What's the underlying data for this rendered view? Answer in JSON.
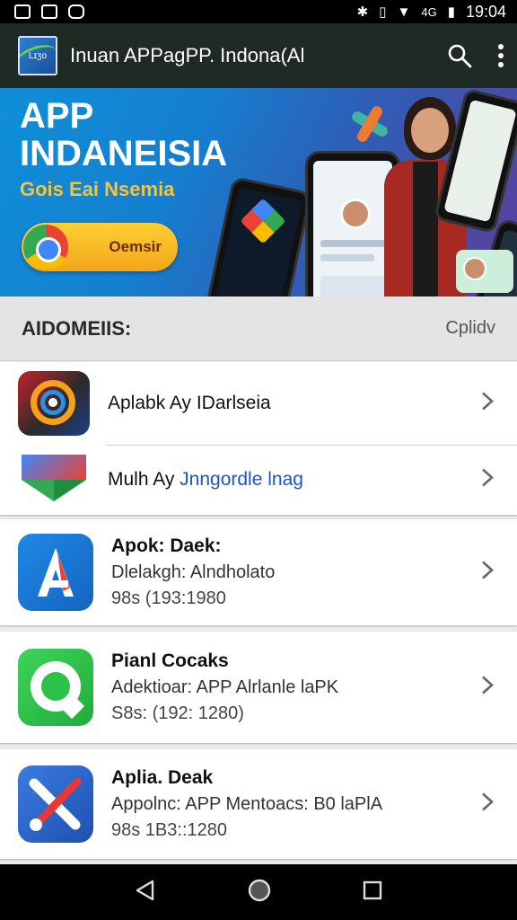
{
  "status_bar": {
    "time": "19:04",
    "network_label": "4G"
  },
  "app_bar": {
    "title": "Inuan APPagPP. Indona(Al",
    "logo_text": "Lɪʒo"
  },
  "banner": {
    "title": "APP\nINDANEISIA",
    "subtitle": "Gois Eai Nsemia",
    "button_label": "Oemsir"
  },
  "section": {
    "title": "AIDOMEIIS:",
    "action": "Cplidv"
  },
  "list": {
    "row1": {
      "title": "Aplabk Ay IDarlseia"
    },
    "row2": {
      "title_prefix": "Mulh Ay",
      "title_link": "Jnngordle lnag"
    },
    "card1": {
      "title": "Apok: Daek:",
      "subtitle": "Dlelakgh: Alndholato",
      "meta": "98s (193:1980"
    },
    "card2": {
      "title": "Pianl Cocaks",
      "subtitle": "Adektioar: APP Alrlanle laPK",
      "meta": "S8s: (192: 1280)"
    },
    "card3": {
      "title": "Aplia. Deak",
      "subtitle": "Appolnc: APP Mentoacs: B0 laPlA",
      "meta": "98s 1B3::1280"
    }
  },
  "colors": {
    "app_bar": "#1e2a23",
    "banner_subtitle": "#f6c33a",
    "banner_button": "#ffcf33",
    "link_blue": "#1c55c4"
  }
}
